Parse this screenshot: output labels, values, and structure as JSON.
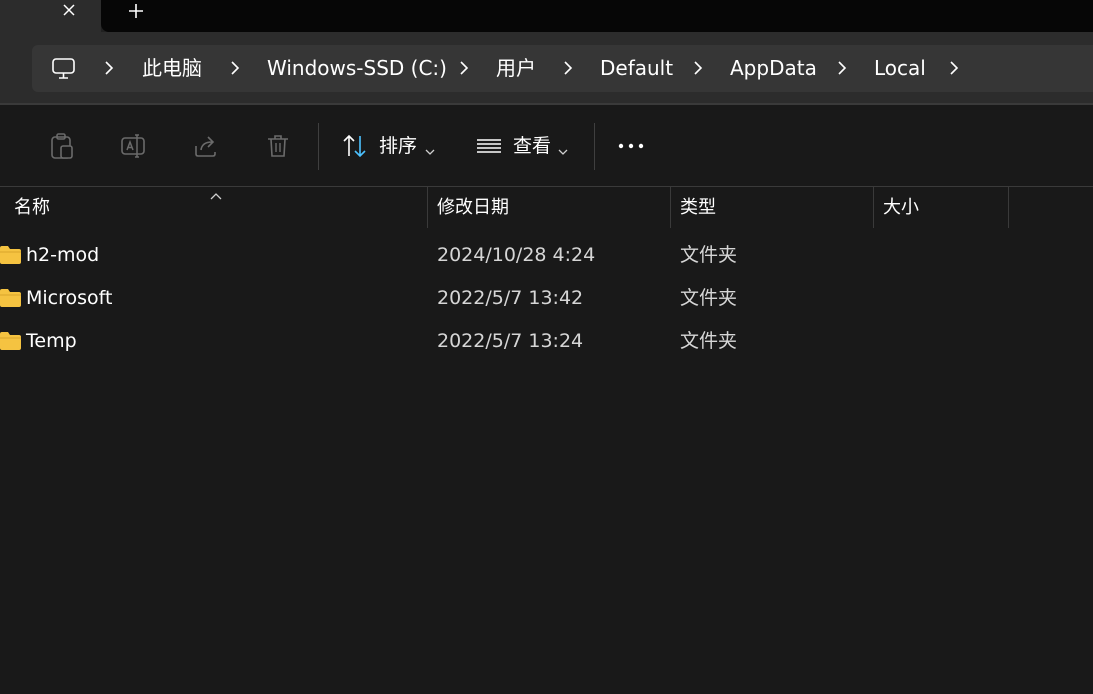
{
  "tabs": {
    "close_icon": "close-icon",
    "new_tab_icon": "plus-icon"
  },
  "address": {
    "root_icon": "computer-icon",
    "crumbs": [
      "此电脑",
      "Windows-SSD (C:)",
      "用户",
      "Default",
      "AppData",
      "Local"
    ]
  },
  "toolbar": {
    "sort_label": "排序",
    "view_label": "查看",
    "more_icon": "more-icon"
  },
  "columns": {
    "name": "名称",
    "modified": "修改日期",
    "type": "类型",
    "size": "大小"
  },
  "rows": [
    {
      "name": "h2-mod",
      "modified": "2024/10/28 4:24",
      "type": "文件夹",
      "size": ""
    },
    {
      "name": "Microsoft",
      "modified": "2022/5/7 13:42",
      "type": "文件夹",
      "size": ""
    },
    {
      "name": "Temp",
      "modified": "2022/5/7 13:24",
      "type": "文件夹",
      "size": ""
    }
  ],
  "colors": {
    "background": "#191919",
    "chrome": "#2c2c2c",
    "address_bar": "#363636",
    "folder": "#f5c341",
    "accent": "#4cc2ff"
  }
}
